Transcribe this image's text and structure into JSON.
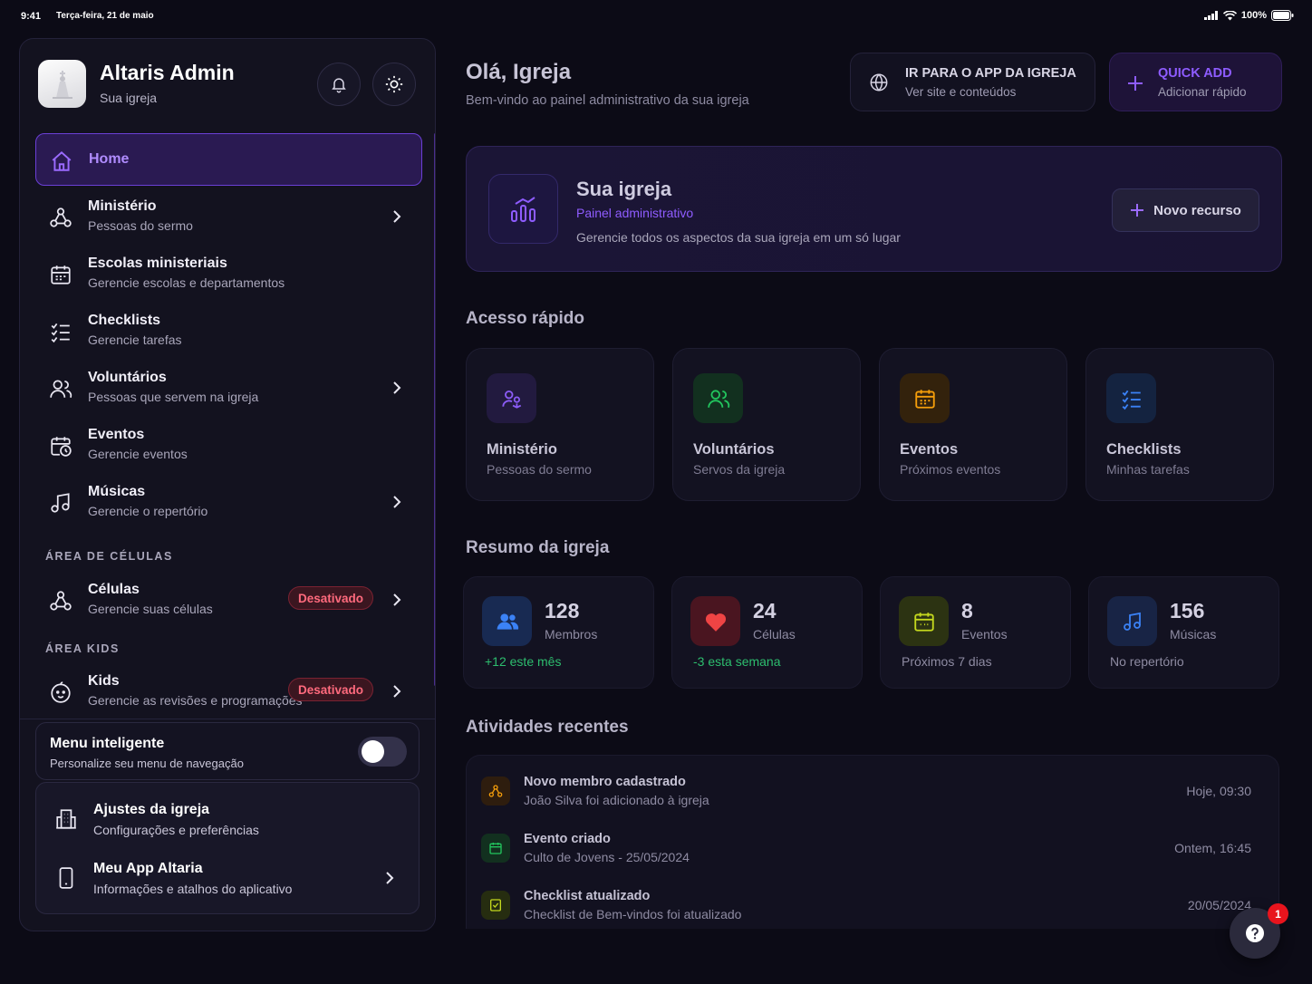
{
  "status_bar": {
    "time": "9:41",
    "date": "Terça-feira, 21 de maio",
    "battery": "100%"
  },
  "sidebar": {
    "admin_name": "Altaris Admin",
    "admin_sub": "Sua igreja",
    "items": [
      {
        "title": "Home",
        "icon": "home-icon"
      },
      {
        "title": "Ministério",
        "sub": "Pessoas do sermo",
        "icon": "network-icon"
      },
      {
        "title": "Escolas ministeriais",
        "sub": "Gerencie escolas e departamentos",
        "icon": "calendar-icon"
      },
      {
        "title": "Checklists",
        "sub": "Gerencie tarefas",
        "icon": "checklist-icon"
      },
      {
        "title": "Voluntários",
        "sub": "Pessoas que servem na igreja",
        "icon": "users-icon"
      },
      {
        "title": "Eventos",
        "sub": "Gerencie eventos",
        "icon": "calendar-clock-icon"
      },
      {
        "title": "Músicas",
        "sub": "Gerencie o repertório",
        "icon": "music-icon"
      }
    ],
    "section_cells": "ÁREA DE CÉLULAS",
    "cells": {
      "title": "Células",
      "sub": "Gerencie suas células",
      "badge": "Desativado"
    },
    "section_kids": "ÁREA KIDS",
    "kids": {
      "title": "Kids",
      "sub": "Gerencie as revisões e programações",
      "badge": "Desativado"
    },
    "smart_menu": {
      "title": "Menu inteligente",
      "sub": "Personalize seu menu de navegação",
      "enabled": false
    },
    "settings": [
      {
        "title": "Ajustes da igreja",
        "sub": "Configurações e preferências"
      },
      {
        "title": "Meu App Altaria",
        "sub": "Informações e atalhos do aplicativo"
      }
    ]
  },
  "header": {
    "greeting": "Olá, Igreja",
    "greeting_sub": "Bem-vindo ao painel administrativo da sua igreja",
    "app_btn": {
      "title": "IR PARA O APP DA IGREJA",
      "sub": "Ver site e conteúdos"
    },
    "quick_add": {
      "title": "QUICK ADD",
      "sub": "Adicionar rápido"
    }
  },
  "hero": {
    "title": "Sua igreja",
    "subtitle": "Painel administrativo",
    "desc": "Gerencie todos os aspectos da sua igreja em um só lugar",
    "button": "Novo recurso"
  },
  "quick_access": {
    "title": "Acesso rápido",
    "cards": [
      {
        "title": "Ministério",
        "sub": "Pessoas do sermo",
        "color": "#8b5cf6"
      },
      {
        "title": "Voluntários",
        "sub": "Servos da igreja",
        "color": "#22c55e"
      },
      {
        "title": "Eventos",
        "sub": "Próximos eventos",
        "color": "#f59e0b"
      },
      {
        "title": "Checklists",
        "sub": "Minhas tarefas",
        "color": "#3b82f6"
      }
    ]
  },
  "summary": {
    "title": "Resumo da igreja",
    "cards": [
      {
        "value": "128",
        "label": "Membros",
        "foot": "+12 este mês"
      },
      {
        "value": "24",
        "label": "Células",
        "foot": "-3 esta semana"
      },
      {
        "value": "8",
        "label": "Eventos",
        "foot": "Próximos 7 dias"
      },
      {
        "value": "156",
        "label": "Músicas",
        "foot": "No repertório"
      }
    ]
  },
  "activities": {
    "title": "Atividades recentes",
    "items": [
      {
        "title": "Novo membro cadastrado",
        "sub": "João Silva foi adicionado à igreja",
        "time": "Hoje, 09:30"
      },
      {
        "title": "Evento criado",
        "sub": "Culto de Jovens - 25/05/2024",
        "time": "Ontem, 16:45"
      },
      {
        "title": "Checklist atualizado",
        "sub": "Checklist de Bem-vindos foi atualizado",
        "time": "20/05/2024"
      }
    ]
  },
  "help": {
    "badge": "1"
  }
}
